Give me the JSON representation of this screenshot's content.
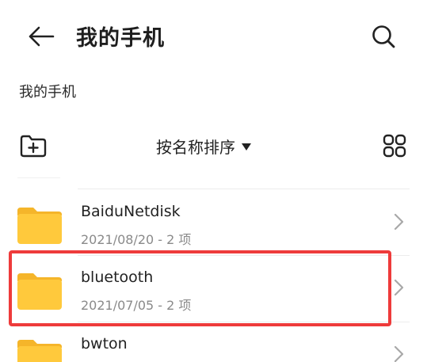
{
  "header": {
    "title": "我的手机"
  },
  "breadcrumb": {
    "path": "我的手机"
  },
  "toolbar": {
    "sort_label": "按名称排序"
  },
  "files": [
    {
      "name": "BaiduNetdisk",
      "meta": "2021/08/20 - 2 项"
    },
    {
      "name": "bluetooth",
      "meta": "2021/07/05 - 2 项",
      "highlighted": true
    },
    {
      "name": "bwton",
      "meta": ""
    }
  ],
  "colors": {
    "folder": "#FFC93C",
    "folder_tab": "#F5B52A",
    "highlight": "#EE3B3B"
  }
}
